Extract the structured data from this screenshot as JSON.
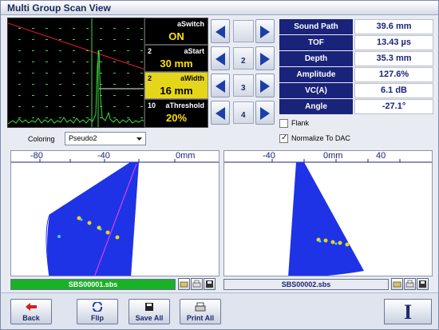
{
  "window": {
    "title": "Multi Group Scan View"
  },
  "params": [
    {
      "num": "",
      "label": "aSwitch",
      "value": "ON",
      "active": false
    },
    {
      "num": "2",
      "label": "aStart",
      "value": "30 mm",
      "active": false
    },
    {
      "num": "2",
      "label": "aWidth",
      "value": "16 mm",
      "active": true
    },
    {
      "num": "10",
      "label": "aThreshold",
      "value": "20%",
      "active": false
    }
  ],
  "group_buttons": [
    "",
    "2",
    "3",
    "4"
  ],
  "measurements": [
    {
      "label": "Sound Path",
      "value": "39.6 mm"
    },
    {
      "label": "TOF",
      "value": "13.43 µs"
    },
    {
      "label": "Depth",
      "value": "35.3 mm"
    },
    {
      "label": "Amplitude",
      "value": "127.6%"
    },
    {
      "label": "VC(A)",
      "value": "6.1 dB"
    },
    {
      "label": "Angle",
      "value": "-27.1°"
    }
  ],
  "options": {
    "flank_label": "Flank",
    "flank_checked": false,
    "normalize_label": "Normalize To DAC",
    "normalize_checked": true
  },
  "coloring": {
    "label": "Coloring",
    "value": "Pseudo2"
  },
  "view1": {
    "ticks": [
      "-80",
      "-40",
      "0mm"
    ],
    "file": "SBS00001.sbs"
  },
  "view2": {
    "ticks": [
      "-40",
      "0mm",
      "40"
    ],
    "file": "SBS00002.sbs"
  },
  "toolbar": {
    "back": "Back",
    "flip": "Flip",
    "save_all": "Save All",
    "print_all": "Print All",
    "info": "I"
  },
  "colors": {
    "scan_blue": "#1e33e6",
    "param_yellow": "#e6d619",
    "label_navy": "#1a237a",
    "file_green": "#18b226"
  }
}
